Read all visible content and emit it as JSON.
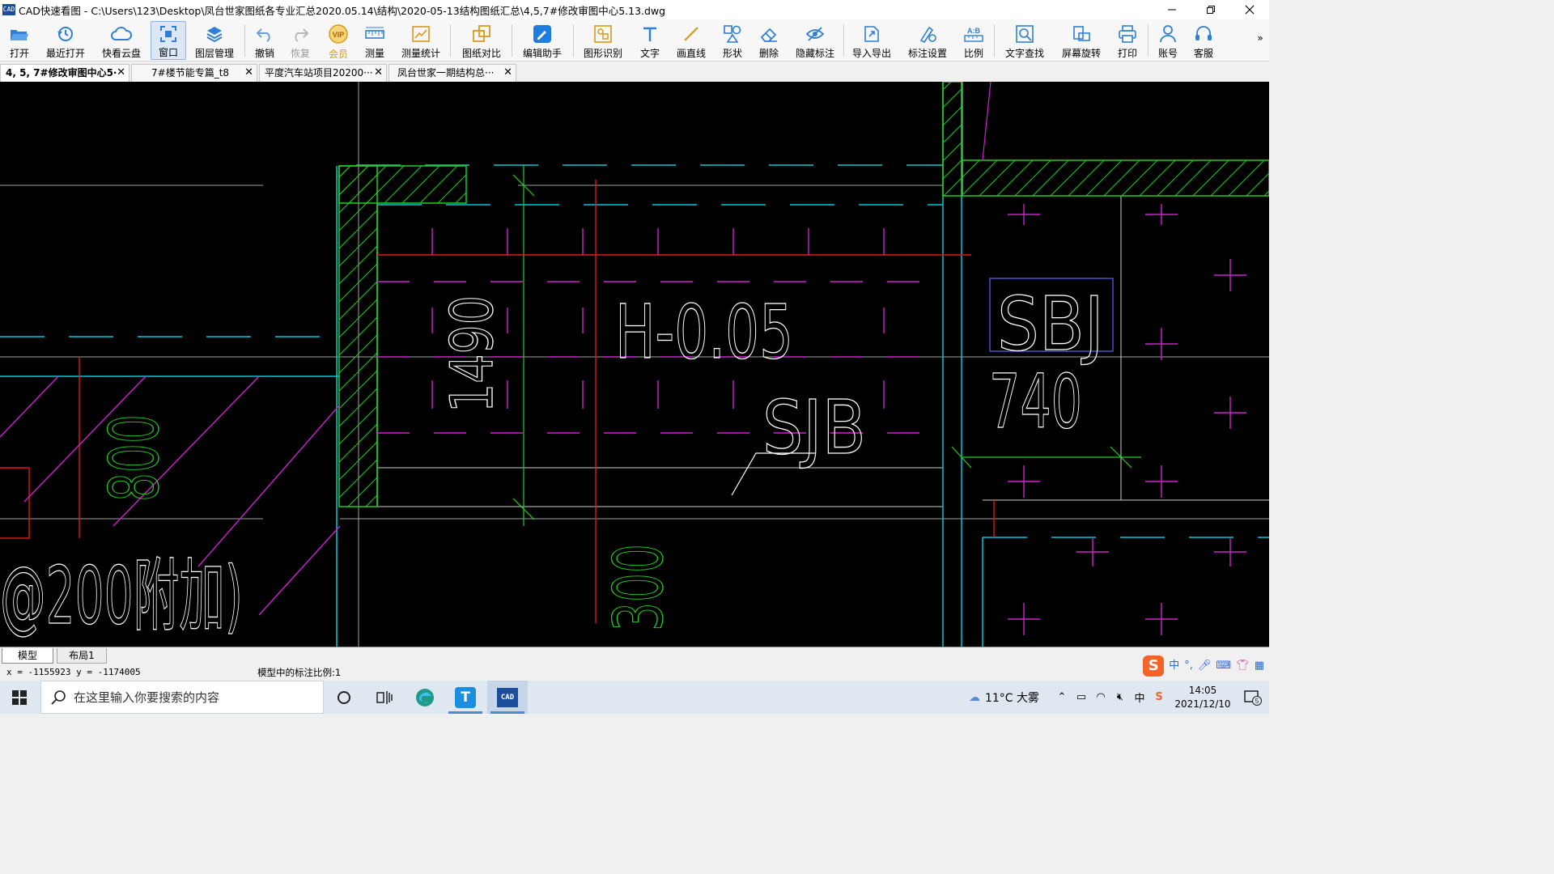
{
  "window": {
    "title": "CAD快速看图 - C:\\Users\\123\\Desktop\\凤台世家图纸各专业汇总2020.05.14\\结构\\2020-05-13结构图纸汇总\\4,5,7#修改审图中心5.13.dwg",
    "app_icon_text": "CAD"
  },
  "toolbar": {
    "items": [
      {
        "key": "open",
        "label": "打开"
      },
      {
        "key": "recent",
        "label": "最近打开"
      },
      {
        "key": "cloud",
        "label": "快看云盘"
      },
      {
        "key": "window",
        "label": "窗口"
      },
      {
        "key": "layers",
        "label": "图层管理"
      },
      {
        "key": "undo",
        "label": "撤销"
      },
      {
        "key": "redo",
        "label": "恢复"
      },
      {
        "key": "vip",
        "label": "会员"
      },
      {
        "key": "measure",
        "label": "测量"
      },
      {
        "key": "measure_stats",
        "label": "测量统计"
      },
      {
        "key": "compare",
        "label": "图纸对比"
      },
      {
        "key": "edit_helper",
        "label": "编辑助手"
      },
      {
        "key": "shape_recog",
        "label": "图形识别"
      },
      {
        "key": "text",
        "label": "文字"
      },
      {
        "key": "line",
        "label": "画直线"
      },
      {
        "key": "shape",
        "label": "形状"
      },
      {
        "key": "delete",
        "label": "删除"
      },
      {
        "key": "hide_marks",
        "label": "隐藏标注"
      },
      {
        "key": "import_export",
        "label": "导入导出"
      },
      {
        "key": "mark_settings",
        "label": "标注设置"
      },
      {
        "key": "scale",
        "label": "比例"
      },
      {
        "key": "text_search",
        "label": "文字查找"
      },
      {
        "key": "rotate",
        "label": "屏幕旋转"
      },
      {
        "key": "print",
        "label": "打印"
      },
      {
        "key": "account",
        "label": "账号"
      },
      {
        "key": "service",
        "label": "客服"
      }
    ],
    "overflow": "»",
    "vip_badge": "VIP",
    "scale_icon_text": "A:B"
  },
  "tabs": [
    {
      "label": "4, 5, 7#修改审图中心5·",
      "active": true
    },
    {
      "label": "7#楼节能专篇_t8",
      "active": false
    },
    {
      "label": "平度汽车站项目20200···",
      "active": false
    },
    {
      "label": "凤台世家一期结构总···",
      "active": false
    }
  ],
  "drawing": {
    "texts": {
      "dim_1490": "1490",
      "elev": "H-0.05",
      "sjb": "SJB",
      "sbj": "SBJ",
      "dim_740": "740",
      "dim_800": "800",
      "dim_300": "300",
      "note": "@200附加)"
    },
    "colors": {
      "cyan": "#00c8d8",
      "magenta": "#d020d0",
      "green": "#20d020",
      "red": "#e01818",
      "white": "#ffffff",
      "gray": "#a0a0a0",
      "blue": "#6060ff"
    }
  },
  "layout_tabs": [
    {
      "label": "模型",
      "active": true
    },
    {
      "label": "布局1",
      "active": false
    }
  ],
  "status": {
    "coords": "x = -1155923  y = -1174005",
    "scale_text": "模型中的标注比例:1"
  },
  "ime": {
    "logo": "S",
    "lang": "中"
  },
  "taskbar": {
    "search_placeholder": "在这里输入你要搜索的内容",
    "cad_icon_text": "CAD",
    "t_icon_text": "T",
    "weather": "11°C  大雾",
    "time": "14:05",
    "date": "2021/12/10",
    "notif_count": "5"
  }
}
